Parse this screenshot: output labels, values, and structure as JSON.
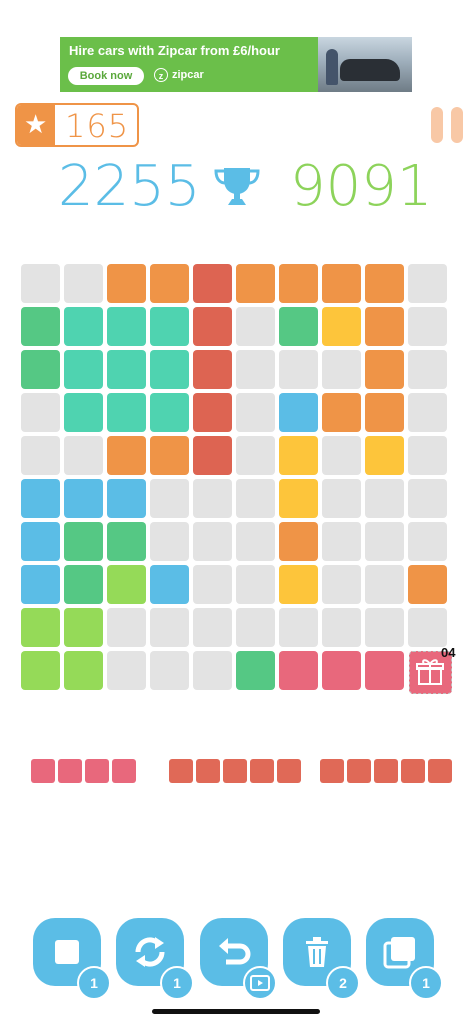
{
  "ad": {
    "title": "Hire cars with Zipcar from £6/hour",
    "button": "Book now",
    "brand": "zipcar",
    "brand_icon_letter": "z",
    "color": "#6bbf4a"
  },
  "header": {
    "stars": "165",
    "star_icon": "star-icon",
    "pause_icon": "pause-icon"
  },
  "scores": {
    "current": "2255",
    "best": "9091",
    "trophy_icon": "trophy-icon"
  },
  "colors": {
    "empty": "#e3e3e3",
    "orange": "#ef9447",
    "red": "#dd6452",
    "teal": "#4fd3b0",
    "green": "#55c884",
    "yellow": "#fdc53b",
    "blue": "#5bbde6",
    "lime": "#95da58",
    "pink": "#e8687c"
  },
  "board": [
    [
      "e",
      "e",
      "o",
      "o",
      "r",
      "o",
      "o",
      "o",
      "o",
      "e"
    ],
    [
      "g",
      "t",
      "t",
      "t",
      "r",
      "e",
      "g",
      "y",
      "o",
      "e"
    ],
    [
      "g",
      "t",
      "t",
      "t",
      "r",
      "e",
      "e",
      "e",
      "o",
      "e"
    ],
    [
      "e",
      "t",
      "t",
      "t",
      "r",
      "e",
      "b",
      "o",
      "o",
      "e"
    ],
    [
      "e",
      "e",
      "o",
      "o",
      "r",
      "e",
      "y",
      "e",
      "y",
      "e"
    ],
    [
      "b",
      "b",
      "b",
      "e",
      "e",
      "e",
      "y",
      "e",
      "e",
      "e"
    ],
    [
      "b",
      "g",
      "g",
      "e",
      "e",
      "e",
      "o",
      "e",
      "e",
      "e"
    ],
    [
      "b",
      "g",
      "l",
      "b",
      "e",
      "e",
      "y",
      "e",
      "e",
      "o"
    ],
    [
      "l",
      "l",
      "e",
      "e",
      "e",
      "e",
      "e",
      "e",
      "e",
      "e"
    ],
    [
      "l",
      "l",
      "e",
      "e",
      "e",
      "g",
      "p",
      "p",
      "p",
      "e"
    ]
  ],
  "gift": {
    "count": "04",
    "icon": "gift-icon"
  },
  "pieces": [
    {
      "color": "pink",
      "blocks": 4
    },
    {
      "color": "red",
      "blocks": 5
    },
    {
      "color": "red",
      "blocks": 5
    }
  ],
  "tools": [
    {
      "name": "single-block",
      "icon": "square-icon",
      "count": "1"
    },
    {
      "name": "refresh",
      "icon": "refresh-icon",
      "count": "1"
    },
    {
      "name": "undo",
      "icon": "undo-icon",
      "count": "",
      "badge_icon": "video-icon"
    },
    {
      "name": "trash",
      "icon": "trash-icon",
      "count": "2"
    },
    {
      "name": "swap",
      "icon": "layers-icon",
      "count": "1"
    }
  ]
}
